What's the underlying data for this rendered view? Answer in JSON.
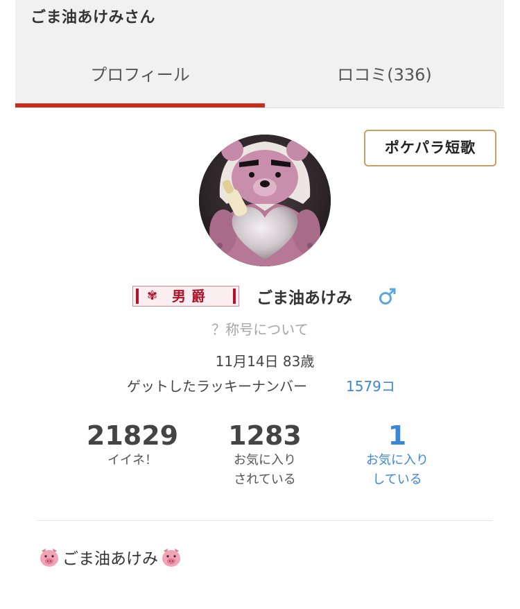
{
  "header": {
    "title": "ごま油あけみさん",
    "tabs": [
      {
        "label": "プロフィール",
        "active": true
      },
      {
        "label": "ロコミ(336)",
        "active": false
      }
    ],
    "accent_color": "#cc2b20"
  },
  "tanka_button": {
    "label": "ポケパラ短歌",
    "border_color": "#c8a063"
  },
  "profile": {
    "avatar_icon": "teddy-bear-avatar",
    "rank": {
      "icon": "flower-crest-icon",
      "label": "男爵"
    },
    "name": "ごま油あけみ",
    "gender_icon": "male-symbol-icon",
    "title_link": "？称号について",
    "birthday": "11月14日 83歳",
    "lucky_number_label": "ゲットしたラッキーナンバー",
    "lucky_number_value": "1579コ",
    "link_color": "#3a86d8"
  },
  "stats": [
    {
      "value": "21829",
      "label_lines": [
        "イイネ！"
      ]
    },
    {
      "value": "1283",
      "label_lines": [
        "お気に入り",
        "されている"
      ]
    },
    {
      "value": "1",
      "label_lines": [
        "お気に入り",
        "している"
      ]
    }
  ],
  "bio": {
    "text": "ごま油あけみ",
    "icon": "pig-face-icon"
  }
}
